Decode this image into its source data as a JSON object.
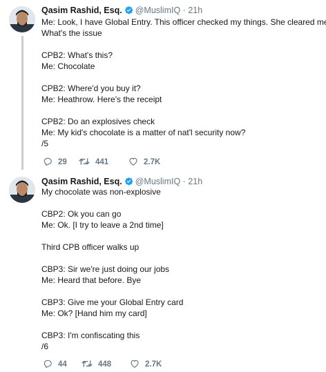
{
  "tweets": [
    {
      "name": "Qasim Rashid, Esq.",
      "handle": "@MuslimIQ",
      "separator": "·",
      "time": "21h",
      "lines": [
        "Me: Look, I have Global Entry. This officer checked my things. She cleared me.",
        "What's the issue",
        "",
        "CPB2: What's this?",
        "Me: Chocolate",
        "",
        "CPB2: Where'd you buy it?",
        "Me: Heathrow. Here's the receipt",
        "",
        "CPB2: Do an explosives check",
        "Me: My kid's chocolate is a matter of nat'l security now?",
        "/5"
      ],
      "replies": "29",
      "retweets": "441",
      "likes": "2.7K"
    },
    {
      "name": "Qasim Rashid, Esq.",
      "handle": "@MuslimIQ",
      "separator": "·",
      "time": "21h",
      "lines": [
        "My chocolate was non-explosive",
        "",
        "CBP2: Ok you can go",
        "Me: Ok. [I try to leave a 2nd time]",
        "",
        "Third CPB officer walks up",
        "",
        "CBP3: Sir we're just doing our jobs",
        "Me: Heard that before. Bye",
        "",
        "CBP3: Give me your Global Entry card",
        "Me: Ok? [Hand him my card]",
        "",
        "CBP3: I'm confiscating this",
        "/6"
      ],
      "replies": "44",
      "retweets": "448",
      "likes": "2.7K"
    }
  ],
  "colors": {
    "verified": "#1da1f2",
    "muted": "#657786",
    "thread_line": "#c4cfd6"
  },
  "icons": [
    "verified-badge-icon",
    "reply-icon",
    "retweet-icon",
    "like-icon"
  ]
}
